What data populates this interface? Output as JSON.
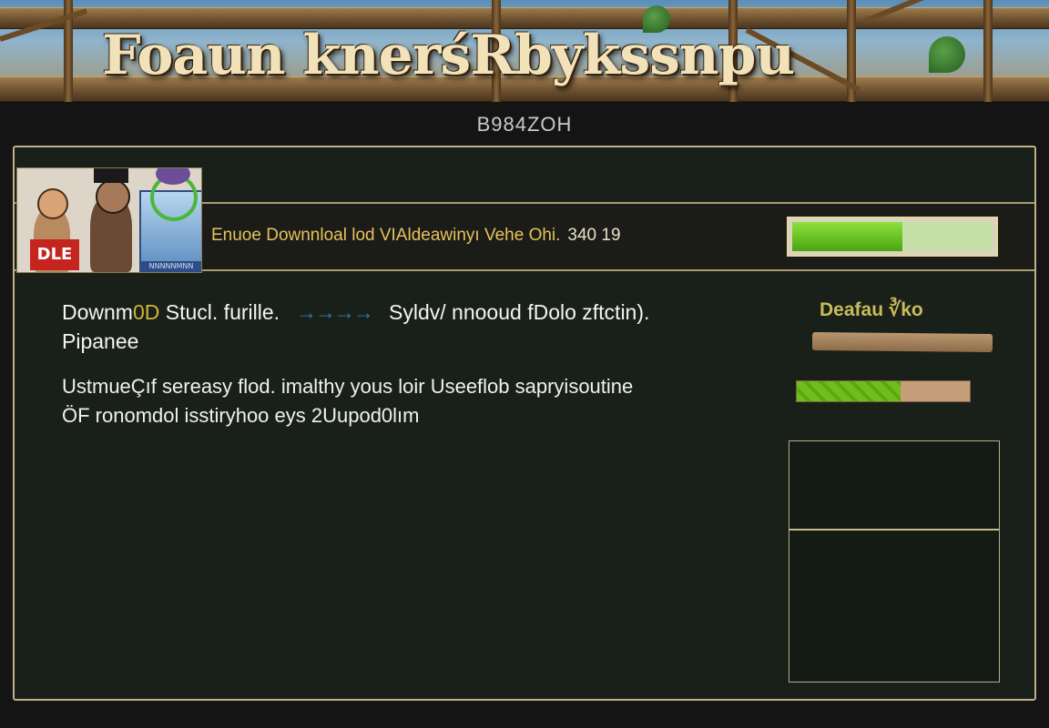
{
  "banner": {
    "title": "Foaun knerśRbykssnpu"
  },
  "subtitle": "B984ZOH",
  "thumbnail": {
    "badge": "DLE",
    "box_label": "NNNNNMNN"
  },
  "download": {
    "info_text": "Enuoe Downnloal lod VIAldeawinyı Vehe Ohi.",
    "info_number": "340 19",
    "progress": 0.55
  },
  "status": {
    "line1_prefix": "Downm",
    "line1_highlight": "0D",
    "line1_mid": " Stucl. furille.",
    "line1_dots": "→→→→",
    "line1_suffix": "Syldv/ nnooud fDolo zftctin).",
    "line2": "Pipanee"
  },
  "side": {
    "label": "Deafau ∛ko"
  },
  "description": {
    "line1": "UstmueÇıf sereasy flod. imalthy yous loir Useeflob sapryisoutine",
    "line2": "ÖF ronomdol isstiryhoo eys 2Uupod0lım",
    "progress": 0.6
  }
}
